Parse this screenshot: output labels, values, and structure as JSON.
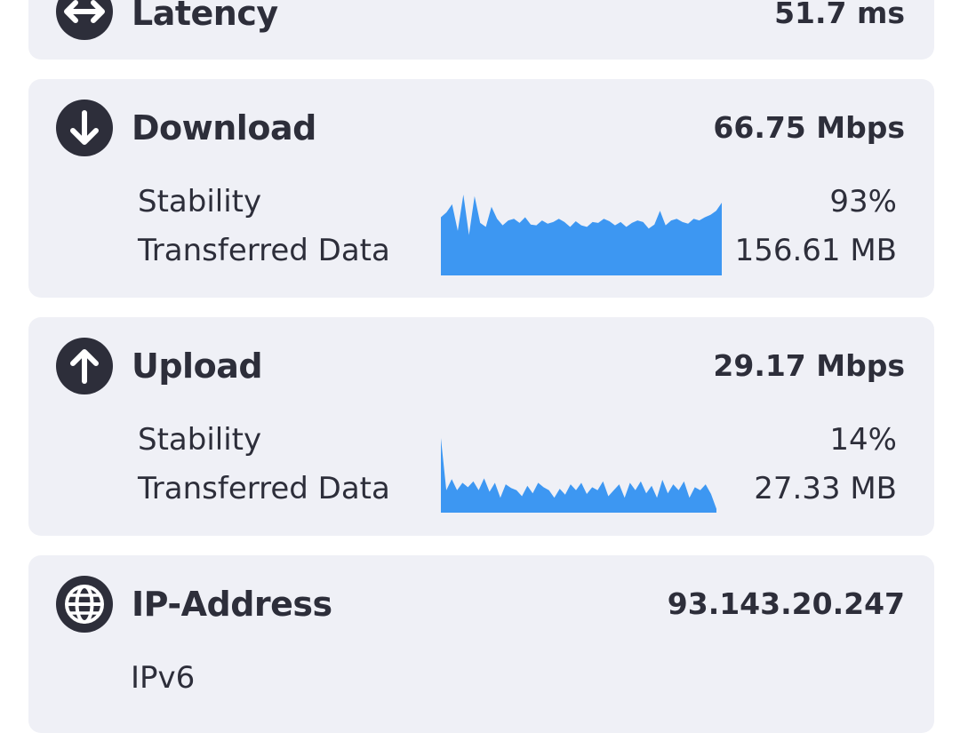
{
  "colors": {
    "card_bg": "#eff0f6",
    "text": "#2d2e3a",
    "sparkline": "#3d97f2"
  },
  "latency": {
    "icon": "arrows-horizontal-icon",
    "title": "Latency",
    "value": "51.7 ms"
  },
  "download": {
    "icon": "arrow-down-icon",
    "title": "Download",
    "value": "66.75 Mbps",
    "stability_label": "Stability",
    "stability_value": "93%",
    "transferred_label": "Transferred Data",
    "transferred_value": "156.61 MB",
    "sparkline": [
      0.72,
      0.78,
      0.88,
      0.55,
      1.0,
      0.5,
      0.98,
      0.65,
      0.6,
      0.85,
      0.7,
      0.62,
      0.68,
      0.7,
      0.65,
      0.72,
      0.63,
      0.62,
      0.68,
      0.64,
      0.66,
      0.7,
      0.66,
      0.6,
      0.67,
      0.62,
      0.6,
      0.66,
      0.65,
      0.7,
      0.67,
      0.62,
      0.66,
      0.6,
      0.65,
      0.68,
      0.66,
      0.58,
      0.63,
      0.8,
      0.62,
      0.68,
      0.7,
      0.66,
      0.64,
      0.7,
      0.68,
      0.72,
      0.75,
      0.8,
      0.9
    ]
  },
  "upload": {
    "icon": "arrow-up-icon",
    "title": "Upload",
    "value": "29.17 Mbps",
    "stability_label": "Stability",
    "stability_value": "14%",
    "transferred_label": "Transferred Data",
    "transferred_value": "27.33 MB",
    "sparkline": [
      1.0,
      0.3,
      0.45,
      0.3,
      0.4,
      0.34,
      0.42,
      0.3,
      0.46,
      0.28,
      0.4,
      0.2,
      0.38,
      0.33,
      0.3,
      0.22,
      0.36,
      0.26,
      0.4,
      0.34,
      0.3,
      0.2,
      0.32,
      0.24,
      0.38,
      0.3,
      0.4,
      0.25,
      0.34,
      0.3,
      0.42,
      0.22,
      0.3,
      0.38,
      0.2,
      0.4,
      0.3,
      0.42,
      0.26,
      0.36,
      0.2,
      0.44,
      0.26,
      0.38,
      0.3,
      0.42,
      0.2,
      0.34,
      0.3,
      0.38,
      0.25,
      0.05
    ]
  },
  "ip": {
    "icon": "globe-icon",
    "title": "IP-Address",
    "value": "93.143.20.247",
    "sub": "IPv6"
  }
}
